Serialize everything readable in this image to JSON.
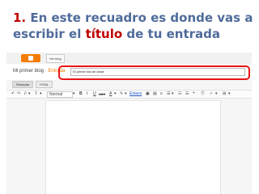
{
  "heading": {
    "number": "1.",
    "before": " En este recuadro es donde vas a escribir el ",
    "highlight": "título",
    "after": " de tu entrada"
  },
  "blogger": {
    "view_blog_label": "Ver blog",
    "blog_name": "Mi primer blog",
    "separator": " · ",
    "entry_label": "Entrada",
    "title_value": "El primer día de clase",
    "tabs": [
      "Redactar",
      "HTML"
    ],
    "toolbar": {
      "font_label": "F",
      "size_label": "T",
      "format_label": "Normal",
      "bold_label": "B",
      "italic_label": "I",
      "underline_label": "U",
      "strike_label": "ABC",
      "link_label": "Enlace"
    }
  }
}
